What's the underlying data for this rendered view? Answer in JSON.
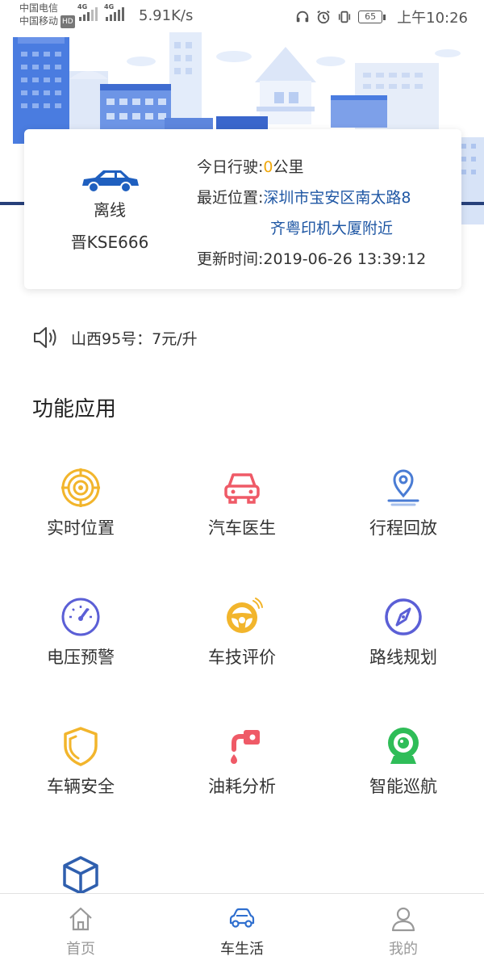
{
  "status_bar": {
    "carrier_1": "中国电信",
    "carrier_2": "中国移动",
    "hd": "HD",
    "net_tag_1": "4G",
    "net_tag_2": "4G",
    "net_speed": "5.91K/s",
    "battery": "65",
    "time": "上午10:26"
  },
  "vehicle": {
    "status": "离线",
    "plate": "晋KSE666",
    "today_label": "今日行驶:",
    "today_value": "0",
    "today_unit": "公里",
    "location_label": "最近位置:",
    "location_line1": "深圳市宝安区南太路8",
    "location_line2": "齐粤印机大厦附近",
    "update_label": "更新时间:",
    "update_value": "2019-06-26 13:39:12"
  },
  "fuel": {
    "text": "山西95号：7元/升"
  },
  "section": {
    "title": "功能应用"
  },
  "functions": [
    {
      "label": "实时位置",
      "icon": "target-icon"
    },
    {
      "label": "汽车医生",
      "icon": "car-doctor-icon"
    },
    {
      "label": "行程回放",
      "icon": "location-pin-icon"
    },
    {
      "label": "电压预警",
      "icon": "gauge-icon"
    },
    {
      "label": "车技评价",
      "icon": "steering-wheel-icon"
    },
    {
      "label": "路线规划",
      "icon": "compass-icon"
    },
    {
      "label": "车辆安全",
      "icon": "shield-icon"
    },
    {
      "label": "油耗分析",
      "icon": "fuel-pump-icon"
    },
    {
      "label": "智能巡航",
      "icon": "camera-icon"
    },
    {
      "label": "",
      "icon": "cube-icon"
    }
  ],
  "nav": [
    {
      "label": "首页",
      "icon": "home-icon"
    },
    {
      "label": "车生活",
      "icon": "car-icon"
    },
    {
      "label": "我的",
      "icon": "user-icon"
    }
  ],
  "colors": {
    "accent_blue": "#1f57a4",
    "highlight_orange": "#f0a80c",
    "icon_gold": "#f2b52c",
    "icon_red": "#ef5a67",
    "icon_purple": "#5b5fd6",
    "icon_green": "#2fbd58"
  }
}
